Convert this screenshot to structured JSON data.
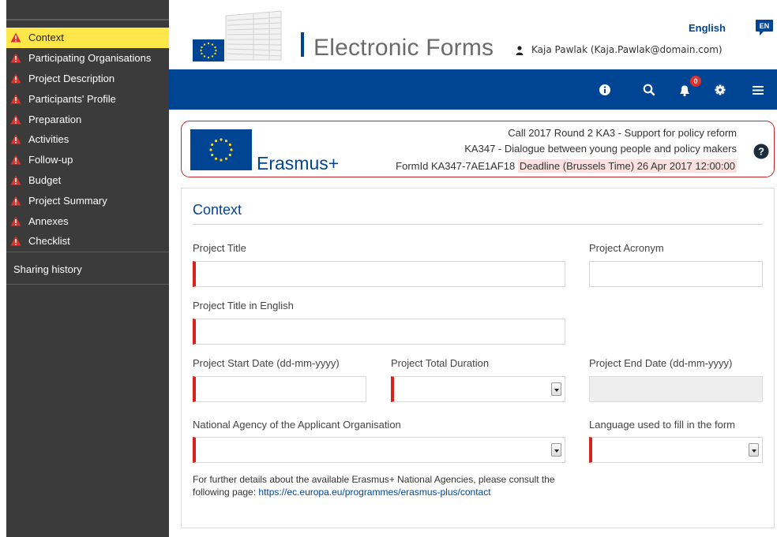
{
  "sidebar": {
    "items": [
      {
        "label": "Context",
        "active": true
      },
      {
        "label": "Participating Organisations",
        "active": false
      },
      {
        "label": "Project Description",
        "active": false
      },
      {
        "label": "Participants' Profile",
        "active": false
      },
      {
        "label": "Preparation",
        "active": false
      },
      {
        "label": "Activities",
        "active": false
      },
      {
        "label": "Follow-up",
        "active": false
      },
      {
        "label": "Budget",
        "active": false
      },
      {
        "label": "Project Summary",
        "active": false
      },
      {
        "label": "Annexes",
        "active": false
      },
      {
        "label": "Checklist",
        "active": false
      }
    ],
    "sharing_history": "Sharing history",
    "item_icon": "warning-icon",
    "warning_color": "#e0312b",
    "active_color": "#ffe74a"
  },
  "header": {
    "app_title": "Electronic Forms",
    "user": "Kaja Pawlak (Kaja.Pawlak@domain.com)",
    "language_label": "English",
    "language_code": "EN",
    "brand_color": "#004494"
  },
  "toolbar": {
    "icons": [
      "info-icon",
      "search-icon",
      "bell-icon",
      "gear-icon",
      "menu-icon"
    ],
    "notification_count": "0"
  },
  "call_info": {
    "program_name": "Erasmus+",
    "line1": "Call 2017  Round 2  KA3 - Support for policy reform",
    "line2": "KA347 - Dialogue between young people and policy makers",
    "formid": "FormId KA347-7AE1AF18",
    "deadline": "Deadline (Brussels Time) 26 Apr 2017 12:00:00"
  },
  "form": {
    "section_title": "Context",
    "fields": {
      "project_title": {
        "label": "Project Title",
        "value": ""
      },
      "project_acronym": {
        "label": "Project Acronym",
        "value": ""
      },
      "project_title_en": {
        "label": "Project Title in English",
        "value": ""
      },
      "start_date": {
        "label": "Project Start Date (dd-mm-yyyy)",
        "value": ""
      },
      "total_duration": {
        "label": "Project Total Duration",
        "value": ""
      },
      "end_date": {
        "label": "Project End Date (dd-mm-yyyy)",
        "value": ""
      },
      "national_agency": {
        "label": "National Agency of the Applicant Organisation",
        "value": ""
      },
      "language": {
        "label": "Language used to fill in the form",
        "value": ""
      }
    },
    "info_text": "For further details about the available Erasmus+ National Agencies, please consult the following page: ",
    "info_link": "https://ec.europa.eu/programmes/erasmus-plus/contact"
  }
}
